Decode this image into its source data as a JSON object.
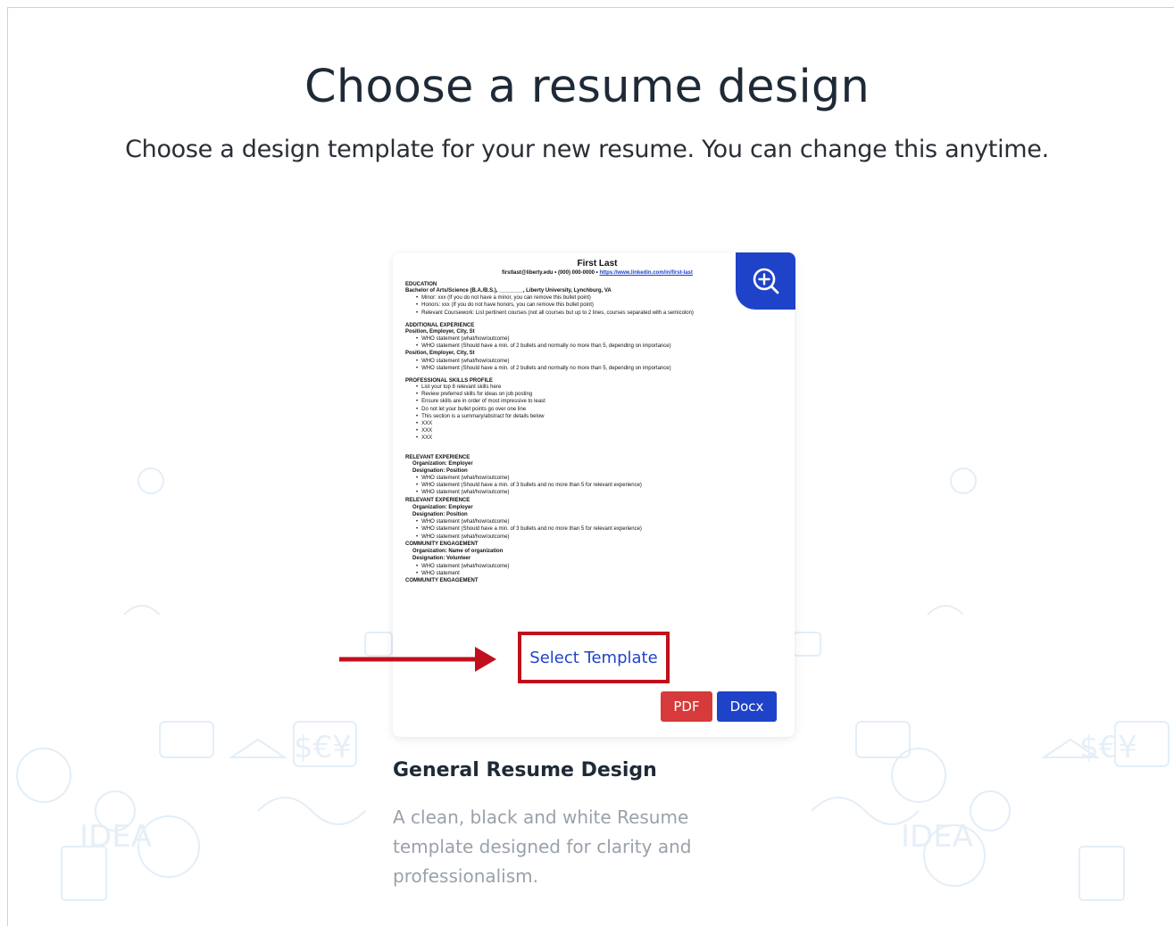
{
  "header": {
    "title": "Choose a resume design",
    "subtitle": "Choose a design template for your new resume. You can change this anytime."
  },
  "template": {
    "name": "General Resume Design",
    "description": "A clean, black and white Resume template designed for clarity and professionalism.",
    "select_label": "Select Template",
    "pdf_label": "PDF",
    "docx_label": "Docx",
    "zoom_icon": "zoom-in-icon"
  },
  "preview": {
    "name": "First Last",
    "contact_prefix": "firstlast@liberty.edu • (000) 000-0000 • ",
    "contact_link": "https://www.linkedin.com/in/first-last",
    "education_heading": "EDUCATION",
    "education_line": "Bachelor of Arts/Science (B.A./B.S.), ________, Liberty University, Lynchburg, VA",
    "education_bullets": [
      "Minor: xxx (If you do not have a minor, you can remove this bullet point)",
      "Honors: xxx (If you do not have honors, you can remove this bullet point)",
      "Relevant Coursework: List pertinent courses (not all courses but up to 2 lines, courses separated with a semicolon)"
    ],
    "additional_heading": "ADDITIONAL EXPERIENCE",
    "position_line": "Position, Employer, City, St",
    "who_line": "WHO statement (what/how/outcome)",
    "who_line_long": "WHO statement (Should have a min. of 2 bullets and normally no more than 5, depending on importance)",
    "skills_heading": "PROFESSIONAL SKILLS PROFILE",
    "skills_bullets": [
      "List your top 8 relevant skills here",
      "Review preferred skills for ideas on job posting",
      "Ensure skills are in order of most impressive to least",
      "Do not let your bullet points go over one line",
      "This section is a summary/abstract for details below",
      "XXX",
      "XXX",
      "XXX"
    ],
    "relevant_heading": "RELEVANT EXPERIENCE",
    "org_line": "Organization: Employer",
    "designation_line": "Designation: Position",
    "who_line_rel": "WHO statement (Should have a min. of 3 bullets and no more than 5 for relevant experience)",
    "community_heading": "COMMUNITY ENGAGEMENT",
    "org_line_comm": "Organization: Name of organization",
    "designation_comm": "Designation: Volunteer",
    "who_statement": "WHO statement"
  }
}
